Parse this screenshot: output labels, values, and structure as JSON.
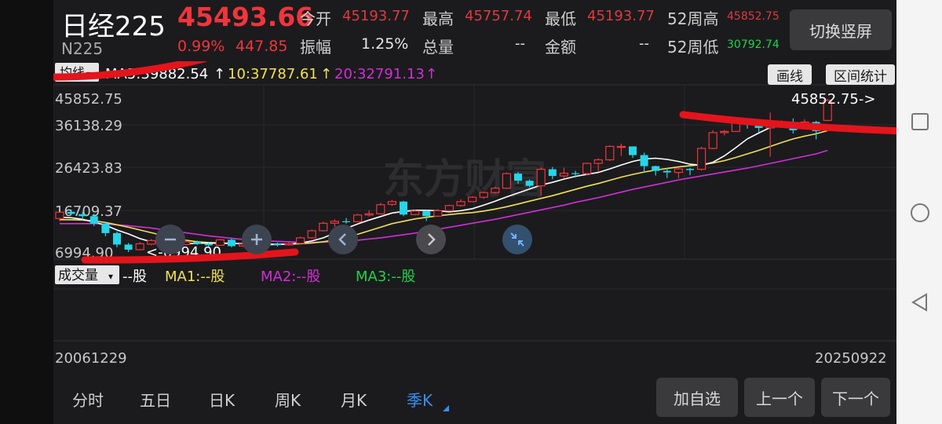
{
  "header": {
    "name": "日经225",
    "code": "N225",
    "price": "45493.66",
    "change_pct": "0.99%",
    "change": "447.85",
    "stats": {
      "open_label": "今开",
      "open": "45193.77",
      "high_label": "最高",
      "high": "45757.74",
      "low_label": "最低",
      "low": "45193.77",
      "high52_label": "52周高",
      "high52": "45852.75",
      "amplitude_label": "振幅",
      "amplitude": "1.25%",
      "volume_label": "总量",
      "volume": "--",
      "amount_label": "金额",
      "amount": "--",
      "low52_label": "52周低",
      "low52": "30792.74"
    },
    "switch_label": "切换竖屏"
  },
  "toolbar": {
    "draw_label": "画线",
    "range_label": "区间统计"
  },
  "indicator_row": {
    "mode": "均线",
    "ma5": "MA5:39882.54",
    "ma10": "10:37787.61",
    "ma20": "20:32791.13"
  },
  "volume_row": {
    "mode": "成交量",
    "vol": "--股",
    "ma1": "MA1:--股",
    "ma2": "MA2:--股",
    "ma3": "MA3:--股"
  },
  "colors": {
    "up": "#f0353d",
    "down": "#25d6e8",
    "ma5": "#ffffff",
    "ma10": "#f2e15a",
    "ma20": "#d12fd6",
    "green": "#22d34a",
    "accent": "#3a8ef0"
  },
  "chart_data": {
    "type": "candlestick",
    "y_ticks": [
      "45852.75",
      "36138.29",
      "26423.83",
      "16709.37",
      "6994.90"
    ],
    "x_start": "20061229",
    "x_end": "20250922",
    "max_annotation": "45852.75->",
    "min_annotation": "<-6994.90",
    "watermark": "东方财富",
    "ylim": [
      6994.9,
      45852.75
    ],
    "candles": [
      [
        15500,
        17100,
        14800,
        17200
      ],
      [
        17200,
        16700,
        16300,
        17800
      ],
      [
        16600,
        16100,
        15200,
        17200
      ],
      [
        16100,
        14200,
        13600,
        16700
      ],
      [
        14200,
        11800,
        11000,
        14500
      ],
      [
        11800,
        8900,
        8200,
        12200
      ],
      [
        8900,
        7600,
        6995,
        9300
      ],
      [
        7600,
        9100,
        7400,
        9500
      ],
      [
        9000,
        9900,
        8700,
        10300
      ],
      [
        9900,
        10100,
        9500,
        10600
      ],
      [
        10100,
        8900,
        8600,
        10400
      ],
      [
        8900,
        9600,
        8700,
        10000
      ],
      [
        9600,
        9100,
        8800,
        9900
      ],
      [
        9100,
        8700,
        8400,
        9400
      ],
      [
        8700,
        10100,
        8600,
        10300
      ],
      [
        10100,
        8500,
        8200,
        10400
      ],
      [
        8500,
        9000,
        8300,
        9300
      ],
      [
        9000,
        8600,
        8300,
        9200
      ],
      [
        8600,
        9200,
        8500,
        9500
      ],
      [
        9200,
        8800,
        8400,
        9400
      ],
      [
        8800,
        9100,
        8600,
        9600
      ],
      [
        9200,
        10600,
        9000,
        10900
      ],
      [
        10600,
        12400,
        10400,
        12700
      ],
      [
        12400,
        14300,
        12200,
        14700
      ],
      [
        14300,
        14800,
        13400,
        15300
      ],
      [
        14800,
        14700,
        14200,
        15600
      ],
      [
        14700,
        16400,
        14600,
        16700
      ],
      [
        16400,
        16700,
        16000,
        17600
      ],
      [
        16700,
        19000,
        16500,
        19500
      ],
      [
        19100,
        19800,
        18700,
        20200
      ],
      [
        19800,
        16500,
        16100,
        20000
      ],
      [
        16500,
        17400,
        16300,
        17700
      ],
      [
        17400,
        16100,
        14900,
        17600
      ],
      [
        16100,
        17500,
        15900,
        17900
      ],
      [
        17500,
        18800,
        17300,
        19000
      ],
      [
        18800,
        19800,
        18500,
        20400
      ],
      [
        19800,
        20900,
        19600,
        21200
      ],
      [
        20900,
        22100,
        20500,
        22400
      ],
      [
        22100,
        23200,
        21800,
        23600
      ],
      [
        23200,
        26900,
        23000,
        27200
      ],
      [
        26900,
        25100,
        24300,
        27300
      ],
      [
        25100,
        23800,
        23400,
        25400
      ],
      [
        23800,
        28000,
        21300,
        28500
      ],
      [
        28000,
        26300,
        25500,
        28600
      ],
      [
        26300,
        27000,
        25800,
        28400
      ],
      [
        27000,
        26900,
        25900,
        27600
      ],
      [
        26900,
        29500,
        26500,
        29700
      ],
      [
        29500,
        30400,
        27300,
        30800
      ],
      [
        30400,
        33800,
        30100,
        34100
      ],
      [
        33800,
        33800,
        31400,
        34500
      ],
      [
        33800,
        31600,
        30900,
        33800
      ],
      [
        31600,
        28800,
        27200,
        32200
      ],
      [
        28800,
        27600,
        26400,
        28900
      ],
      [
        27600,
        27200,
        25800,
        28300
      ],
      [
        27200,
        28100,
        25700,
        28500
      ],
      [
        28100,
        27800,
        26500,
        28400
      ],
      [
        28000,
        33300,
        27700,
        33700
      ],
      [
        33300,
        37300,
        33100,
        37900
      ],
      [
        37300,
        37600,
        36600,
        38000
      ],
      [
        37600,
        40300,
        37500,
        40400
      ],
      [
        40300,
        40100,
        38300,
        40900
      ],
      [
        40300,
        38500,
        37300,
        40600
      ],
      [
        38500,
        38900,
        31200,
        42400
      ],
      [
        38900,
        39800,
        38800,
        40400
      ],
      [
        39800,
        37900,
        37100,
        40900
      ],
      [
        39500,
        40000,
        39300,
        40700
      ],
      [
        40000,
        37700,
        35600,
        40300
      ],
      [
        40400,
        45493,
        40200,
        45853
      ]
    ],
    "ma5": [
      15800,
      15700,
      15300,
      14600,
      13800,
      12600,
      11600,
      10400,
      9600,
      9300,
      9000,
      9100,
      9200,
      9300,
      9200,
      9200,
      9100,
      8900,
      8900,
      8900,
      9000,
      9300,
      9800,
      10600,
      11800,
      13000,
      14100,
      15100,
      16000,
      16900,
      17300,
      17600,
      17600,
      17500,
      17200,
      17500,
      18000,
      18900,
      19900,
      21000,
      22000,
      23000,
      24000,
      24700,
      25500,
      26200,
      26700,
      27200,
      28100,
      29100,
      30000,
      30600,
      30800,
      30500,
      30000,
      29300,
      29000,
      29800,
      31400,
      33500,
      35700,
      37200,
      38600,
      39100,
      39200,
      39300,
      38800,
      39000
    ],
    "ma10": [
      15200,
      15200,
      15100,
      14900,
      14500,
      13900,
      13300,
      12600,
      11900,
      11200,
      10500,
      10000,
      9600,
      9400,
      9300,
      9200,
      9100,
      9100,
      9000,
      9000,
      9000,
      9100,
      9300,
      9600,
      10100,
      10700,
      11500,
      12400,
      13300,
      14200,
      14800,
      15400,
      15800,
      16200,
      16500,
      16800,
      17000,
      17400,
      17900,
      18500,
      19200,
      19900,
      20600,
      21300,
      22100,
      22900,
      23700,
      24400,
      25200,
      26000,
      26700,
      27300,
      27800,
      28200,
      28600,
      28900,
      29200,
      29600,
      30200,
      31000,
      31900,
      32800,
      33800,
      34800,
      35700,
      36400,
      37000,
      37800
    ],
    "ma20": [
      14200,
      14200,
      14200,
      14200,
      14100,
      13900,
      13700,
      13400,
      13100,
      12700,
      12300,
      11900,
      11500,
      11100,
      10800,
      10500,
      10200,
      10000,
      9800,
      9700,
      9600,
      9500,
      9500,
      9500,
      9600,
      9800,
      10000,
      10300,
      10600,
      11000,
      11400,
      11800,
      12300,
      12800,
      13300,
      13800,
      14300,
      14800,
      15300,
      15900,
      16500,
      17100,
      17700,
      18300,
      18900,
      19600,
      20200,
      20800,
      21500,
      22200,
      22900,
      23500,
      24100,
      24700,
      25300,
      25800,
      26300,
      26800,
      27300,
      27800,
      28300,
      28900,
      29500,
      30100,
      30700,
      31300,
      31900,
      32800
    ]
  },
  "tabs": [
    "分时",
    "五日",
    "日K",
    "周K",
    "月K",
    "季K"
  ],
  "active_tab": "季K",
  "buttons": {
    "add_watch": "加自选",
    "prev": "上一个",
    "next": "下一个"
  }
}
